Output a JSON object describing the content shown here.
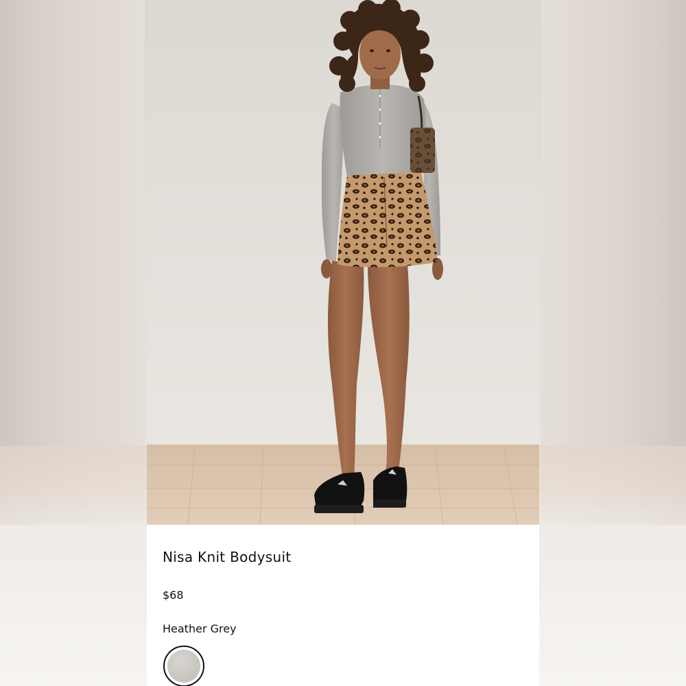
{
  "product": {
    "name": "Nisa Knit Bodysuit",
    "price": "$68",
    "color_name": "Heather Grey"
  },
  "swatches": [
    {
      "label": "Heather Grey",
      "color": "#c9c5c0",
      "selected": true
    }
  ],
  "colors": {
    "text": "#111111",
    "card_background": "#ffffff",
    "wall": "#e4e0da",
    "floor": "#d9c4ad"
  },
  "image": {
    "subject": "product-photo"
  }
}
